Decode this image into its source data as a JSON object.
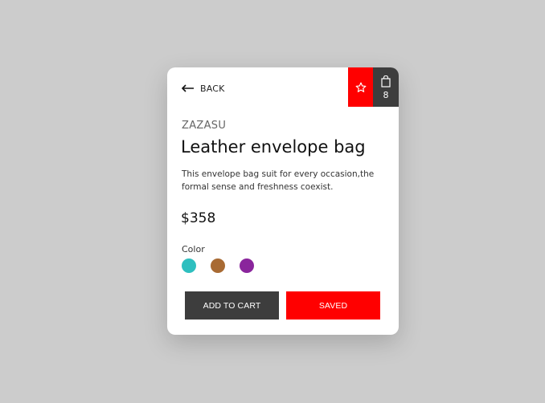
{
  "nav": {
    "back_label": "BACK"
  },
  "header": {
    "favorite_icon": "star-outline-icon",
    "cart_icon": "shopping-bag-icon",
    "cart_count": "8"
  },
  "product": {
    "brand": "ZAZASU",
    "name": "Leather envelope bag",
    "description": "This envelope bag suit for every occasion,the formal sense and freshness coexist.",
    "price": "$358",
    "color_label": "Color",
    "colors": [
      {
        "name": "teal",
        "hex": "#2ebfbf"
      },
      {
        "name": "brown",
        "hex": "#a86a33"
      },
      {
        "name": "purple",
        "hex": "#8a259c"
      }
    ]
  },
  "actions": {
    "add_to_cart_label": "ADD TO CART",
    "saved_label": "SAVED"
  },
  "theme": {
    "accent": "#ff0000",
    "dark": "#3d3d3d",
    "background": "#cccccc"
  }
}
